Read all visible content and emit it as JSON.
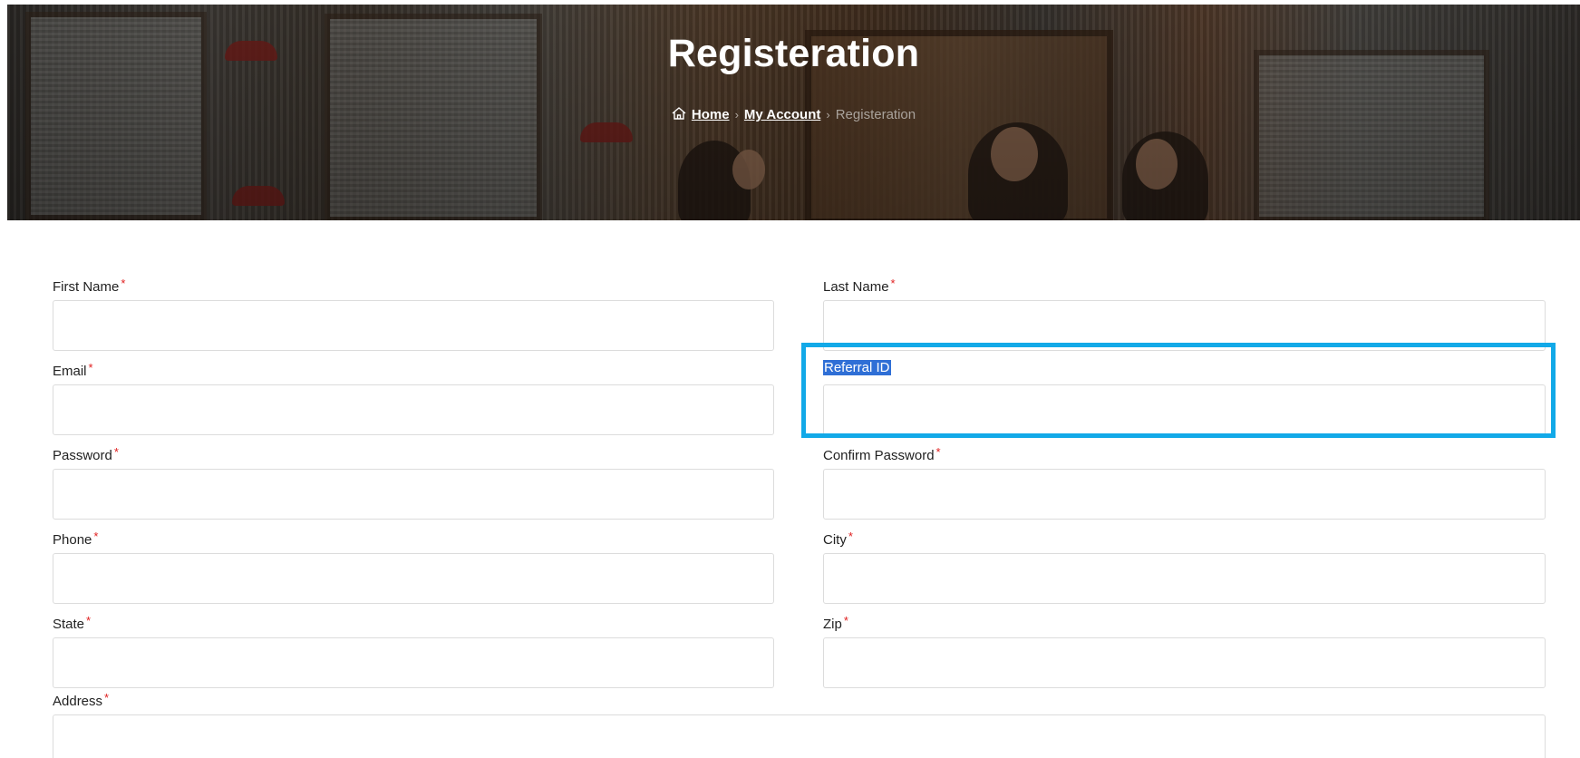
{
  "hero": {
    "title": "Registeration"
  },
  "breadcrumb": {
    "home": "Home",
    "account": "My Account",
    "current": "Registeration",
    "separator": "›"
  },
  "form": {
    "required_mark": "*",
    "first_name": {
      "label": "First Name",
      "value": ""
    },
    "last_name": {
      "label": "Last Name",
      "value": ""
    },
    "email": {
      "label": "Email",
      "value": ""
    },
    "referral_id": {
      "label": "Referral ID",
      "value": ""
    },
    "password": {
      "label": "Password",
      "value": ""
    },
    "confirm_password": {
      "label": "Confirm Password",
      "value": ""
    },
    "phone": {
      "label": "Phone",
      "value": ""
    },
    "city": {
      "label": "City",
      "value": ""
    },
    "state": {
      "label": "State",
      "value": ""
    },
    "zip": {
      "label": "Zip",
      "value": ""
    },
    "address": {
      "label": "Address",
      "value": ""
    }
  },
  "colors": {
    "highlight": "#12a9e8",
    "required": "#e02020",
    "selection": "#2f6fd6"
  }
}
